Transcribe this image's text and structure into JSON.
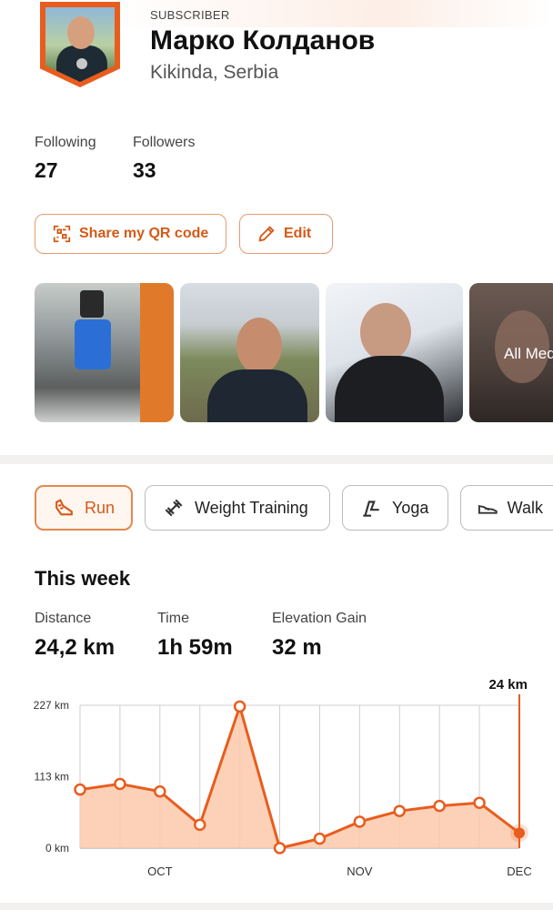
{
  "profile": {
    "badge": "SUBSCRIBER",
    "name": "Марко Колданов",
    "location": "Kikinda, Serbia"
  },
  "stats": {
    "following_label": "Following",
    "following_value": "27",
    "followers_label": "Followers",
    "followers_value": "33"
  },
  "actions": {
    "share_qr": "Share my QR code",
    "edit": "Edit"
  },
  "photos": {
    "all_media_label": "All Med"
  },
  "sports": {
    "tabs": [
      "Run",
      "Weight Training",
      "Yoga",
      "Walk"
    ],
    "selected": "Run"
  },
  "week": {
    "title": "This week",
    "distance_label": "Distance",
    "distance_value": "24,2 km",
    "time_label": "Time",
    "time_value": "1h 59m",
    "elevation_label": "Elevation Gain",
    "elevation_value": "32 m"
  },
  "colors": {
    "accent": "#e85d1e",
    "accent_fill": "#fbc9ab"
  },
  "chart_data": {
    "type": "area",
    "title": "",
    "xlabel": "",
    "ylabel": "",
    "ylim": [
      0,
      227
    ],
    "y_ticks": [
      "0 km",
      "113 km",
      "227 km"
    ],
    "x_ticks": [
      {
        "label": "OCT",
        "index": 2
      },
      {
        "label": "NOV",
        "index": 7
      },
      {
        "label": "DEC",
        "index": 11
      }
    ],
    "values": [
      93,
      102,
      90,
      37,
      225,
      0,
      15,
      42,
      59,
      67,
      72,
      24
    ],
    "highlight_label": "24 km",
    "grid": true
  }
}
